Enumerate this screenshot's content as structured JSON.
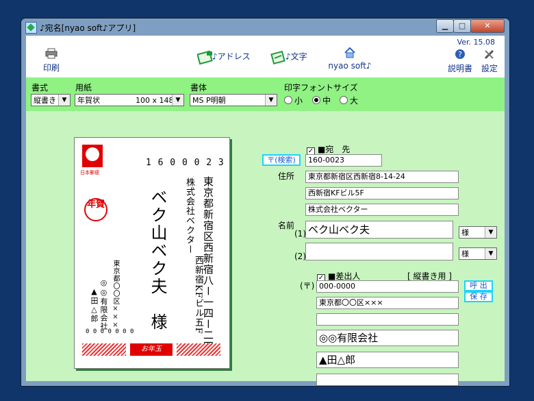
{
  "window": {
    "title": "♪宛名[nyao soft♪アプリ]",
    "min": "▁",
    "max": "□",
    "close": "✕"
  },
  "toolbar": {
    "print": "印刷",
    "address": "♪アドレス",
    "text": "♪文字",
    "home": "nyao soft♪",
    "help": "説明書",
    "settings": "設定",
    "version": "Ver. 15.08"
  },
  "options": {
    "format_label": "書式",
    "format_value": "縦書き",
    "paper_label": "用紙",
    "paper_value": "年賀状",
    "paper_size": "100 x 148",
    "font_label": "書体",
    "font_value": "MS P明朝",
    "size_label": "印字フォントサイズ",
    "size_small": "小",
    "size_medium": "中",
    "size_large": "大"
  },
  "card": {
    "postcode": "1 6 0 0 0 2 3",
    "addr_line1": "東京都新宿区西新宿八ー一四ー二四",
    "addr_line2": "西新宿KFビル五F",
    "company": "株式会社ベクター",
    "recipient": "ベク山ベク夫　様",
    "sender_addr": "東京都〇〇区×××",
    "sender_company": "◎◎有限会社",
    "sender_name": "▲田△郎",
    "sender_postcode": "0 0 0 0 0 0 0",
    "stamp_caption": "日本郵便",
    "nenga": "年賀",
    "otoshidama": "お年玉"
  },
  "recipient": {
    "section_label": "■宛　先",
    "zip_search": "〒(検索)",
    "zip": "160-0023",
    "address_label": "住所",
    "address1": "東京都新宿区西新宿8-14-24",
    "address2": "西新宿KFビル5F",
    "address3": "株式会社ベクター",
    "name_label": "名前",
    "name1_idx": "(1)",
    "name1": "ベク山ベク夫",
    "honorific1": "様",
    "name2_idx": "(2)",
    "name2": "",
    "honorific2": "様"
  },
  "sender": {
    "section_label": "■差出人",
    "mode": "[ 縦書き用 ]",
    "zip_label": "(〒)",
    "zip": "000-0000",
    "call_button": "呼 出",
    "save_button": "保 存",
    "address1": "東京都〇〇区×××",
    "address2": "",
    "company": "◎◎有限会社",
    "name": "▲田△郎",
    "extra": ""
  }
}
